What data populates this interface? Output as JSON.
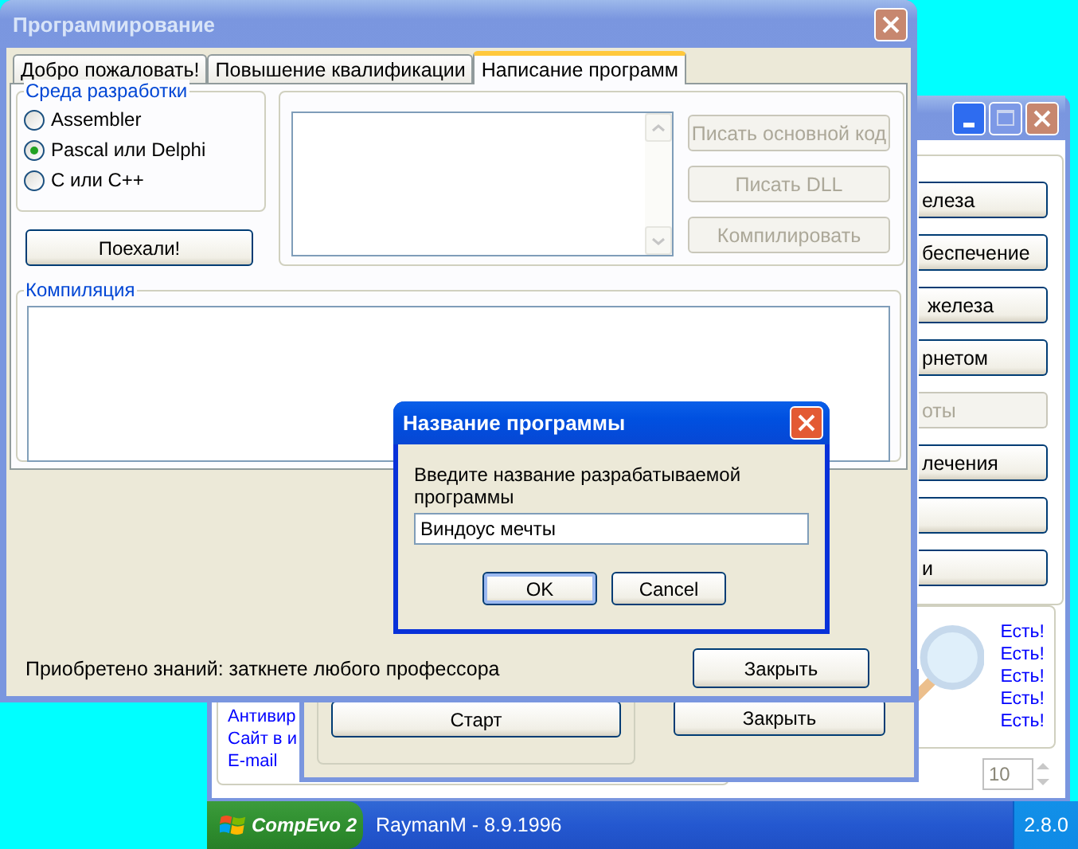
{
  "main_window": {
    "buttons": [
      {
        "label": "елеза",
        "disabled": false
      },
      {
        "label": "беспечение",
        "disabled": false
      },
      {
        "label": " железа",
        "disabled": false
      },
      {
        "label": "рнетом",
        "disabled": false
      },
      {
        "label": "оты",
        "disabled": true
      },
      {
        "label": "лечения",
        "disabled": false
      },
      {
        "disabled": false
      },
      {
        "label": "и",
        "disabled": false
      }
    ],
    "links": [
      "Антивир",
      "Сайт в и",
      "E-mail"
    ],
    "statuses": [
      "Есть!",
      "Есть!",
      "Есть!",
      "Есть!",
      "Есть!"
    ],
    "spin_value": "10"
  },
  "tester_window": {
    "buttons": [
      "Старт",
      "Закрыть"
    ]
  },
  "program_window": {
    "title": "Программирование",
    "tabs": [
      {
        "label": "Добро пожаловать!",
        "selected": false
      },
      {
        "label": "Повышение квалификации",
        "selected": false
      },
      {
        "label": "Написание программ",
        "selected": true
      }
    ],
    "environment": {
      "title": "Среда разработки",
      "options": [
        {
          "label": "Assembler",
          "selected": false
        },
        {
          "label": "Pascal или Delphi",
          "selected": true
        },
        {
          "label": "C или C++",
          "selected": false
        }
      ]
    },
    "go_button": "Поехали!",
    "actions": [
      {
        "label": "Писать основной код",
        "disabled": true
      },
      {
        "label": "Писать DLL",
        "disabled": true
      },
      {
        "label": "Компилировать",
        "disabled": true
      }
    ],
    "compile_group": "Компиляция",
    "status": "Приобретено знаний: заткнете любого профессора",
    "close_button": "Закрыть"
  },
  "dialog": {
    "title": "Название программы",
    "prompt": "Введите название разрабатываемой программы",
    "value": "Виндоус мечты",
    "buttons": [
      {
        "label": "OK",
        "default": true
      },
      {
        "label": "Cancel",
        "default": false
      }
    ]
  },
  "taskbar": {
    "start": "CompEvo 2",
    "title": "RaymanM - 8.9.1996",
    "clock": "2.8.0"
  }
}
